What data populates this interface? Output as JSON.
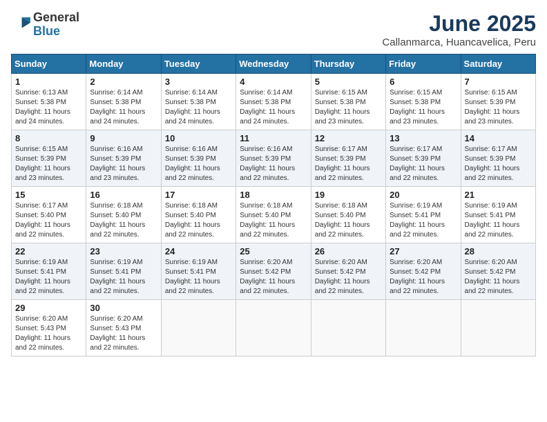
{
  "header": {
    "logo_general": "General",
    "logo_blue": "Blue",
    "title": "June 2025",
    "subtitle": "Callanmarca, Huancavelica, Peru"
  },
  "weekdays": [
    "Sunday",
    "Monday",
    "Tuesday",
    "Wednesday",
    "Thursday",
    "Friday",
    "Saturday"
  ],
  "weeks": [
    [
      {
        "day": "1",
        "info": "Sunrise: 6:13 AM\nSunset: 5:38 PM\nDaylight: 11 hours\nand 24 minutes."
      },
      {
        "day": "2",
        "info": "Sunrise: 6:14 AM\nSunset: 5:38 PM\nDaylight: 11 hours\nand 24 minutes."
      },
      {
        "day": "3",
        "info": "Sunrise: 6:14 AM\nSunset: 5:38 PM\nDaylight: 11 hours\nand 24 minutes."
      },
      {
        "day": "4",
        "info": "Sunrise: 6:14 AM\nSunset: 5:38 PM\nDaylight: 11 hours\nand 24 minutes."
      },
      {
        "day": "5",
        "info": "Sunrise: 6:15 AM\nSunset: 5:38 PM\nDaylight: 11 hours\nand 23 minutes."
      },
      {
        "day": "6",
        "info": "Sunrise: 6:15 AM\nSunset: 5:38 PM\nDaylight: 11 hours\nand 23 minutes."
      },
      {
        "day": "7",
        "info": "Sunrise: 6:15 AM\nSunset: 5:39 PM\nDaylight: 11 hours\nand 23 minutes."
      }
    ],
    [
      {
        "day": "8",
        "info": "Sunrise: 6:15 AM\nSunset: 5:39 PM\nDaylight: 11 hours\nand 23 minutes."
      },
      {
        "day": "9",
        "info": "Sunrise: 6:16 AM\nSunset: 5:39 PM\nDaylight: 11 hours\nand 23 minutes."
      },
      {
        "day": "10",
        "info": "Sunrise: 6:16 AM\nSunset: 5:39 PM\nDaylight: 11 hours\nand 22 minutes."
      },
      {
        "day": "11",
        "info": "Sunrise: 6:16 AM\nSunset: 5:39 PM\nDaylight: 11 hours\nand 22 minutes."
      },
      {
        "day": "12",
        "info": "Sunrise: 6:17 AM\nSunset: 5:39 PM\nDaylight: 11 hours\nand 22 minutes."
      },
      {
        "day": "13",
        "info": "Sunrise: 6:17 AM\nSunset: 5:39 PM\nDaylight: 11 hours\nand 22 minutes."
      },
      {
        "day": "14",
        "info": "Sunrise: 6:17 AM\nSunset: 5:39 PM\nDaylight: 11 hours\nand 22 minutes."
      }
    ],
    [
      {
        "day": "15",
        "info": "Sunrise: 6:17 AM\nSunset: 5:40 PM\nDaylight: 11 hours\nand 22 minutes."
      },
      {
        "day": "16",
        "info": "Sunrise: 6:18 AM\nSunset: 5:40 PM\nDaylight: 11 hours\nand 22 minutes."
      },
      {
        "day": "17",
        "info": "Sunrise: 6:18 AM\nSunset: 5:40 PM\nDaylight: 11 hours\nand 22 minutes."
      },
      {
        "day": "18",
        "info": "Sunrise: 6:18 AM\nSunset: 5:40 PM\nDaylight: 11 hours\nand 22 minutes."
      },
      {
        "day": "19",
        "info": "Sunrise: 6:18 AM\nSunset: 5:40 PM\nDaylight: 11 hours\nand 22 minutes."
      },
      {
        "day": "20",
        "info": "Sunrise: 6:19 AM\nSunset: 5:41 PM\nDaylight: 11 hours\nand 22 minutes."
      },
      {
        "day": "21",
        "info": "Sunrise: 6:19 AM\nSunset: 5:41 PM\nDaylight: 11 hours\nand 22 minutes."
      }
    ],
    [
      {
        "day": "22",
        "info": "Sunrise: 6:19 AM\nSunset: 5:41 PM\nDaylight: 11 hours\nand 22 minutes."
      },
      {
        "day": "23",
        "info": "Sunrise: 6:19 AM\nSunset: 5:41 PM\nDaylight: 11 hours\nand 22 minutes."
      },
      {
        "day": "24",
        "info": "Sunrise: 6:19 AM\nSunset: 5:41 PM\nDaylight: 11 hours\nand 22 minutes."
      },
      {
        "day": "25",
        "info": "Sunrise: 6:20 AM\nSunset: 5:42 PM\nDaylight: 11 hours\nand 22 minutes."
      },
      {
        "day": "26",
        "info": "Sunrise: 6:20 AM\nSunset: 5:42 PM\nDaylight: 11 hours\nand 22 minutes."
      },
      {
        "day": "27",
        "info": "Sunrise: 6:20 AM\nSunset: 5:42 PM\nDaylight: 11 hours\nand 22 minutes."
      },
      {
        "day": "28",
        "info": "Sunrise: 6:20 AM\nSunset: 5:42 PM\nDaylight: 11 hours\nand 22 minutes."
      }
    ],
    [
      {
        "day": "29",
        "info": "Sunrise: 6:20 AM\nSunset: 5:43 PM\nDaylight: 11 hours\nand 22 minutes."
      },
      {
        "day": "30",
        "info": "Sunrise: 6:20 AM\nSunset: 5:43 PM\nDaylight: 11 hours\nand 22 minutes."
      },
      null,
      null,
      null,
      null,
      null
    ]
  ]
}
